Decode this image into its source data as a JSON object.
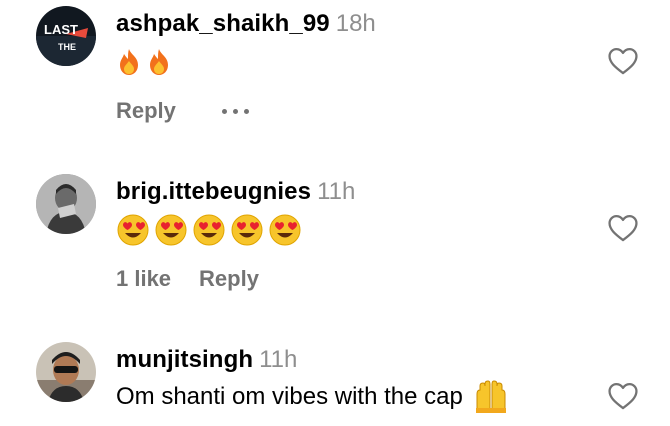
{
  "comments": [
    {
      "username": "ashpak_shaikh_99",
      "time": "18h",
      "emojis": [
        "fire-icon",
        "fire-icon"
      ],
      "reply_label": "Reply",
      "avatar_text_top": "LAST",
      "avatar_text_bottom": "THE"
    },
    {
      "username": "brig.ittebeugnies",
      "time": "11h",
      "emojis": [
        "heart-eyes-emoji",
        "heart-eyes-emoji",
        "heart-eyes-emoji",
        "heart-eyes-emoji",
        "heart-eyes-emoji"
      ],
      "likes_label": "1 like",
      "reply_label": "Reply"
    },
    {
      "username": "munjitsingh",
      "time": "11h",
      "text": "Om shanti om vibes with the cap",
      "emoji": "raising-hands-emoji"
    }
  ],
  "colors": {
    "secondary_text": "#737373",
    "time_text": "#8e8e8e",
    "emoji_yellow": "#f7c52b",
    "emoji_heart": "#e8222f",
    "fire_orange": "#f2711c"
  }
}
